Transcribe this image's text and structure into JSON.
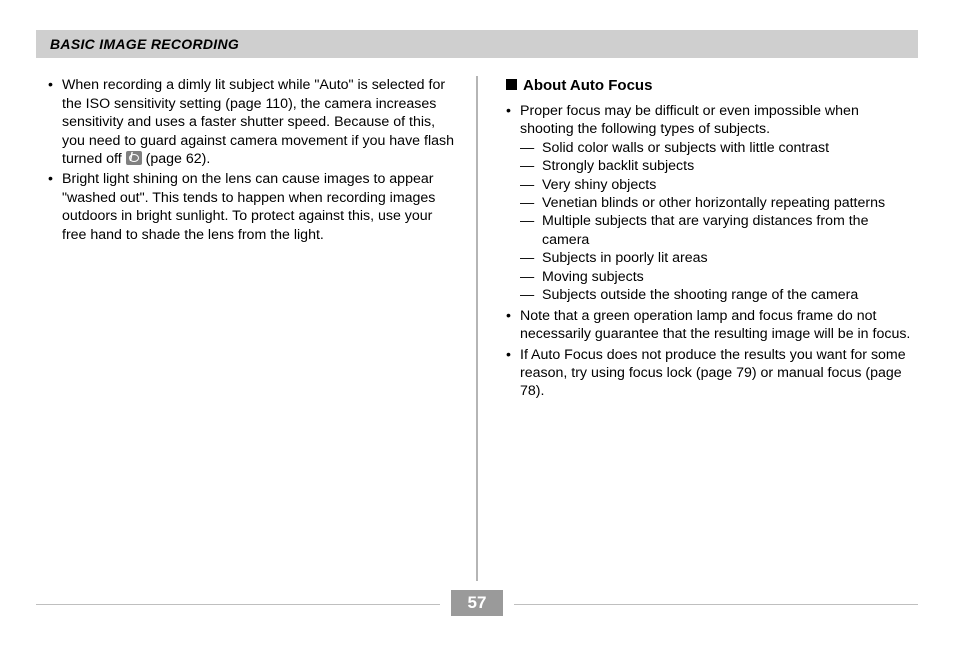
{
  "section_title": "BASIC IMAGE RECORDING",
  "page_number": "57",
  "left": {
    "bullets": [
      {
        "pre": "When recording a dimly lit subject while \"Auto\" is selected for the ISO sensitivity setting (page 110), the camera increases sensitivity and uses a faster shutter speed. Because of this, you need to guard against camera movement if you have flash turned off ",
        "post": " (page 62)."
      },
      {
        "pre": "Bright light shining on the lens can cause images to appear \"washed out\". This tends to happen when recording images outdoors in bright sunlight. To protect against this, use your free hand to shade the lens from the light."
      }
    ]
  },
  "right": {
    "heading": "About Auto Focus",
    "bullet1_intro": "Proper focus may be difficult or even impossible when shooting the following types of subjects.",
    "bullet1_dashes": [
      "Solid color walls or subjects with little contrast",
      "Strongly backlit subjects",
      "Very shiny objects",
      "Venetian blinds or other horizontally repeating patterns",
      "Multiple subjects that are varying distances from the camera",
      "Subjects in poorly lit areas",
      "Moving subjects",
      "Subjects outside the shooting range of the camera"
    ],
    "bullet2": "Note that a green operation lamp and focus frame do not necessarily guarantee that the resulting image will be in focus.",
    "bullet3": "If Auto Focus does not produce the results you want for some reason, try using focus lock (page 79) or manual focus (page 78)."
  }
}
